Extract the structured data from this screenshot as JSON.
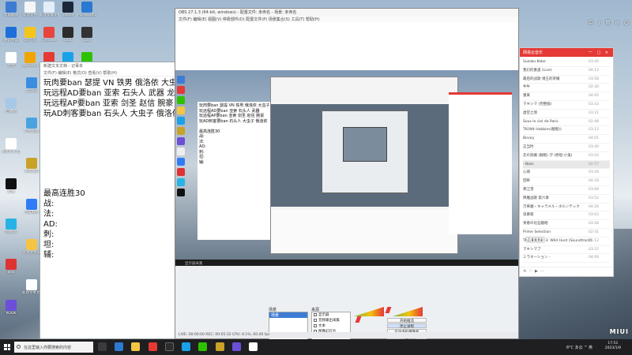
{
  "desktop": {
    "icons": [
      {
        "label": "智能翻译",
        "color": "#3d7bd4"
      },
      {
        "label": "新建文件",
        "color": "#f6f6f6"
      },
      {
        "label": "新建文本文档",
        "color": "#e3eef9"
      },
      {
        "label": "Steam",
        "color": "#1b2838"
      },
      {
        "label": "Microsoft Edge",
        "color": "#2b79d1"
      },
      {
        "label": "腾讯会议",
        "color": "#1e6fd9"
      },
      {
        "label": "QQ音乐",
        "color": "#f5c518"
      },
      {
        "label": "Chrome",
        "color": "#e8453c"
      },
      {
        "label": "OBS",
        "color": "#2c2c2c"
      },
      {
        "label": "Epic",
        "color": "#333"
      },
      {
        "label": "文档",
        "color": "#ffffff"
      },
      {
        "label": "WeGame",
        "color": "#f0a500"
      },
      {
        "label": "网易云",
        "color": "#e53935"
      },
      {
        "label": "QQ",
        "color": "#1aa1e8"
      },
      {
        "label": "微信",
        "color": "#2dc100"
      },
      {
        "label": "此电脑",
        "color": "#3a8de0"
      },
      {
        "label": "回收站",
        "color": "#a8c8e8"
      },
      {
        "label": "控制面板",
        "color": "#4aa3df"
      },
      {
        "label": "新建文本文档",
        "color": "#ffffff"
      },
      {
        "label": "英雄联盟",
        "color": "#c9a227"
      },
      {
        "label": "剪映",
        "color": "#111"
      },
      {
        "label": "百度网盘",
        "color": "#2f7cf6"
      },
      {
        "label": "网易UU",
        "color": "#27b3e6"
      },
      {
        "label": "新建文件夹",
        "color": "#f4c542"
      },
      {
        "label": "录屏",
        "color": "#d33"
      },
      {
        "label": "新建文本文档",
        "color": "#ffffff"
      },
      {
        "label": "KOOK",
        "color": "#6b4fd8"
      }
    ]
  },
  "editor": {
    "title": "新建文本文档 - 记事本",
    "menu": "文件(F)  编辑(E)  格式(O)  查看(V)  帮助(H)",
    "lines_top": [
      "玩肉要ban 瑟提  VN    铁男  俄洛依  大虫子",
      "玩远程AD要ban  亚索  石头人  武器   龙女",
      "玩远程AP要ban    亚索    剑圣   赵信  腕豪  卡",
      "玩AD刺客要ban    石头人  大虫子  俄洛依"
    ],
    "lines_bottom": [
      "最高连胜30",
      "战:",
      "法:",
      "  AD:",
      "刺:",
      "坦:",
      "辅:"
    ]
  },
  "obs": {
    "title": "OBS 27.1.3 (64-bit, windows) - 配置文件: 未命名 - 场景: 未命名",
    "menu": "文件(F)  编辑(E)  视图(V)  停靠部件(D)  配置文件(P)  场景集合(S)  工具(T)  帮助(H)",
    "nested_text": [
      "玩肉要ban 瑟提 VN  铁男  俄洛依  大虫子",
      "玩远程AD要ban  亚索  石头人  武器",
      "玩远程AP要ban   亚索  剑圣  赵信  腕豪",
      "玩AD刺客要ban   石头人  大虫子  俄洛依",
      "",
      "最高连胜30",
      "战:",
      "法:",
      " AD:",
      "刺:",
      "坦:",
      "辅:"
    ],
    "strip_label": "显示器采集",
    "scenes_title": "场景",
    "scene_selected": "场景",
    "sources_title": "来源",
    "sources": [
      "显示器",
      "音频输出采集",
      "文本",
      "图像幻灯片"
    ],
    "controls": {
      "start_stream": "开始推流",
      "stop_record": "停止录制",
      "virtual_cam": "启动虚拟摄像机",
      "studio": "工作室模式",
      "settings": "设置",
      "exit": "退出"
    },
    "status": "LIVE: 00:00:00    REC: 00:05:32    CPU: 8.1%, 60.00 fps"
  },
  "music": {
    "header": "网易云音乐",
    "controls": "一 □ ×",
    "tracks": [
      {
        "name": "Suzaku Kobe",
        "time": "03:45"
      },
      {
        "name": "我们的重逢 (Live)",
        "time": "04:12"
      },
      {
        "name": "最后的战歌 诸王的荣耀",
        "time": "03:58"
      },
      {
        "name": "牛牛",
        "time": "02:30"
      },
      {
        "name": "重来",
        "time": "04:05"
      },
      {
        "name": "マキシマ (完整版)",
        "time": "03:33"
      },
      {
        "name": "虚空之境",
        "time": "03:21"
      },
      {
        "name": "Sous le ciel de Paris",
        "time": "02:48"
      },
      {
        "name": "TK(Wit Hobbies(翻唱))",
        "time": "03:12"
      },
      {
        "name": "Binary",
        "time": "04:01"
      },
      {
        "name": "正当时",
        "time": "03:40"
      },
      {
        "name": "恋の抱擁 (翻唱) 汐 (原唱-小鬼)",
        "time": "03:16"
      },
      {
        "name": "- Boss",
        "time": "02:57"
      },
      {
        "name": "心病",
        "time": "03:44"
      },
      {
        "name": "回眸",
        "time": "04:18"
      },
      {
        "name": "寒江雪",
        "time": "03:09"
      },
      {
        "name": "降魔战歌 第六章",
        "time": "03:52"
      },
      {
        "name": "万華鏡・キャラメル・ホルンテック",
        "time": "04:26"
      },
      {
        "name": "思慕家",
        "time": "03:03"
      },
      {
        "name": "青春の化石翻唱",
        "time": "03:28"
      },
      {
        "name": "Prime Selection",
        "time": "02:41"
      },
      {
        "name": "The Witcher 3: Wild Hunt (Soundtrack)",
        "time": "05:12"
      },
      {
        "name": "マキシマブ",
        "time": "03:37"
      },
      {
        "name": "ミラネーション -",
        "time": "04:09"
      }
    ]
  },
  "logo": "MIUI",
  "tray_top": "中 ♪ 简 ⚙ ☺",
  "taskbar": {
    "search_placeholder": "在这里输入你要搜索的内容",
    "tray": "8°C 多云  ^ 英",
    "time": "17:51",
    "date": "2023/1/9"
  }
}
